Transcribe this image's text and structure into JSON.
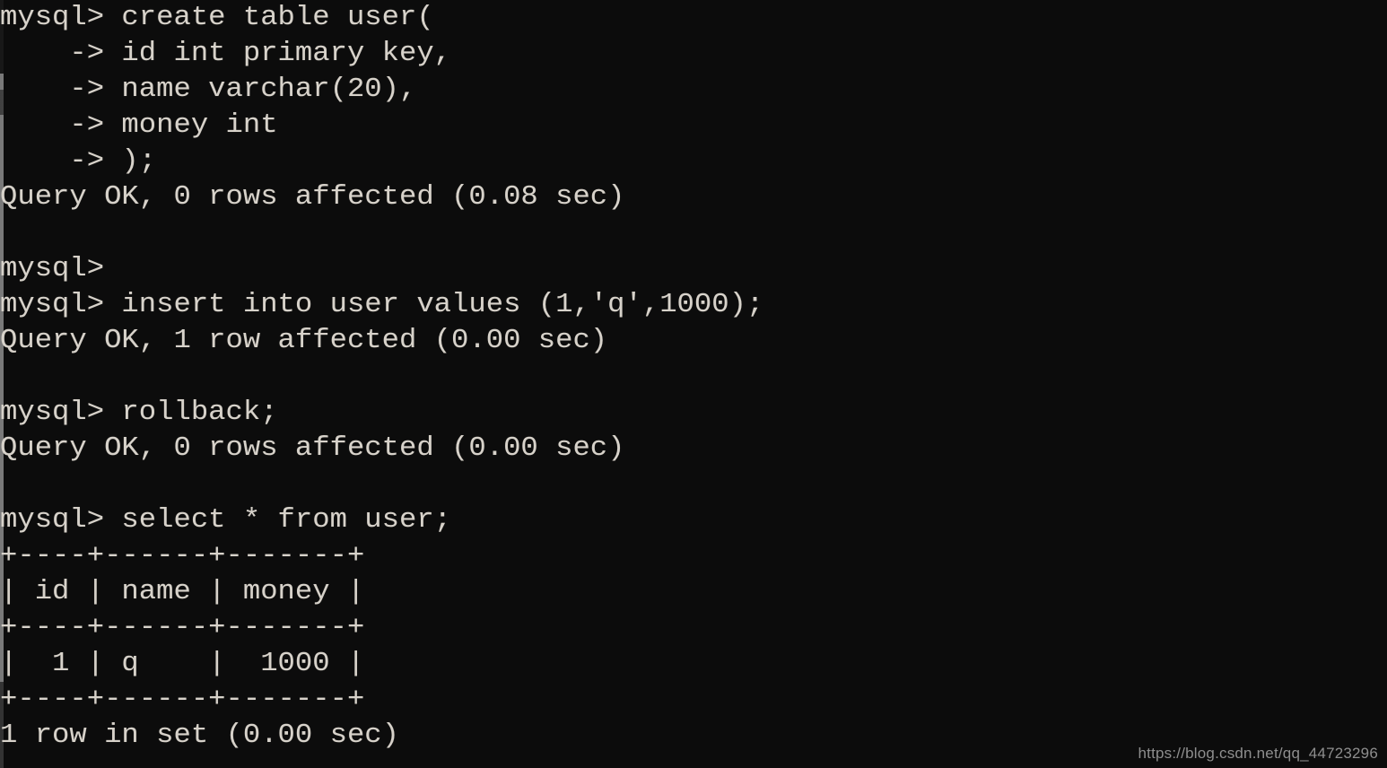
{
  "terminal": {
    "background_color": "#0c0c0c",
    "text_color": "#d7d2ca",
    "prompt": "mysql>",
    "continuation_prompt": "->",
    "lines": [
      "mysql> create table user(",
      "    -> id int primary key,",
      "    -> name varchar(20),",
      "    -> money int",
      "    -> );",
      "Query OK, 0 rows affected (0.08 sec)",
      "",
      "mysql>",
      "mysql> insert into user values (1,'q',1000);",
      "Query OK, 1 row affected (0.00 sec)",
      "",
      "mysql> rollback;",
      "Query OK, 0 rows affected (0.00 sec)",
      "",
      "mysql> select * from user;",
      "+----+------+-------+",
      "| id | name | money |",
      "+----+------+-------+",
      "|  1 | q    |  1000 |",
      "+----+------+-------+",
      "1 row in set (0.00 sec)"
    ],
    "statements": [
      "create table user( id int primary key, name varchar(20), money int );",
      "insert into user values (1,'q',1000);",
      "rollback;",
      "select * from user;"
    ],
    "results": [
      "Query OK, 0 rows affected (0.08 sec)",
      "Query OK, 1 row affected (0.00 sec)",
      "Query OK, 0 rows affected (0.00 sec)",
      "1 row in set (0.00 sec)"
    ],
    "result_table": {
      "columns": [
        "id",
        "name",
        "money"
      ],
      "rows": [
        [
          "1",
          "q",
          "1000"
        ]
      ],
      "row_count_label": "1 row in set (0.00 sec)"
    }
  },
  "watermark": {
    "text": "https://blog.csdn.net/qq_44723296",
    "color": "#8e8e8e"
  }
}
